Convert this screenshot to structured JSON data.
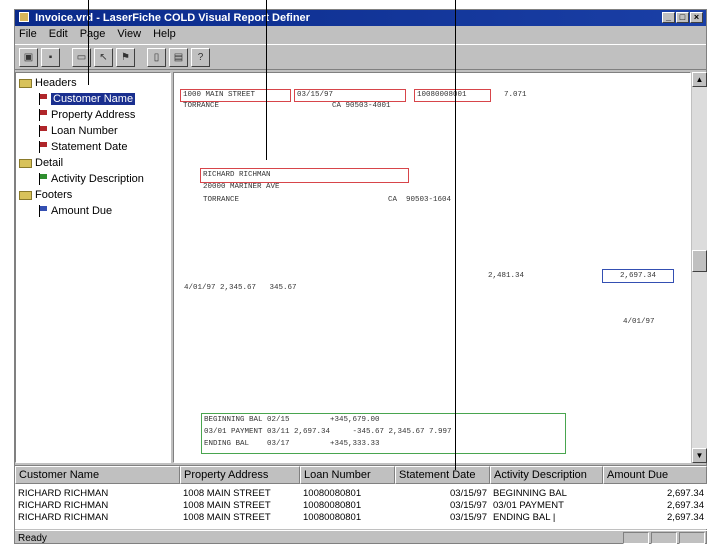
{
  "window": {
    "title": "Invoice.vrd - LaserFiche COLD Visual Report Definer",
    "controls": [
      "_",
      "□",
      "×"
    ]
  },
  "menu": [
    "File",
    "Edit",
    "Page",
    "View",
    "Help"
  ],
  "toolbar": {
    "buttons": [
      "open-icon",
      "save-icon",
      "field-icon",
      "select-icon",
      "flag-icon",
      "copy-icon",
      "paste-icon",
      "help-icon"
    ]
  },
  "tree": {
    "headers_label": "Headers",
    "headers_items": [
      "Customer Name",
      "Property Address",
      "Loan Number",
      "Statement Date"
    ],
    "detail_label": "Detail",
    "detail_items": [
      "Activity Description"
    ],
    "footers_label": "Footers",
    "footers_items": [
      "Amount Due"
    ],
    "colors": {
      "red_flag": "#b0262a",
      "green_flag": "#2f8f2f",
      "selected": "#1a2f8f"
    }
  },
  "report": {
    "line1_street": "1000 MAIN STREET",
    "line1_date": "03/15/97",
    "line1_loan": "10080008001",
    "line1_extra": "7.071",
    "line2_city": "TORRANCE",
    "line2_state": "CA 90503-4001",
    "name": "RICHARD RICHMAN",
    "addr1": "20000 MARINER AVE",
    "city": "TORRANCE",
    "state_zip": "CA  90503-1604",
    "amt_mid": "2,481.34",
    "amt_box": "2,697.34",
    "row_date_amt": "4/01/97 2,345.67   345.67",
    "date_right": "4/01/97",
    "detail1": "BEGINNING BAL 02/15         +345,679.00",
    "detail2": "03/01 PAYMENT 03/11 2,697.34     -345.67 2,345.67 7.997",
    "detail3": "ENDING BAL    03/17         +345,333.33"
  },
  "grid": {
    "headers": [
      "Customer Name",
      "Property Address",
      "Loan Number",
      "Statement Date",
      "Activity Description",
      "Amount Due"
    ],
    "rows": [
      [
        "RICHARD RICHMAN",
        "1008 MAIN STREET",
        "10080080801",
        "03/15/97",
        "BEGINNING BAL",
        "2,697.34"
      ],
      [
        "RICHARD RICHMAN",
        "1008 MAIN STREET",
        "10080080801",
        "03/15/97",
        "03/01 PAYMENT",
        "2,697.34"
      ],
      [
        "RICHARD RICHMAN",
        "1008 MAIN STREET",
        "10080080801",
        "03/15/97",
        "ENDING BAL   |",
        "2,697.34"
      ]
    ]
  },
  "status": {
    "text": "Ready"
  }
}
